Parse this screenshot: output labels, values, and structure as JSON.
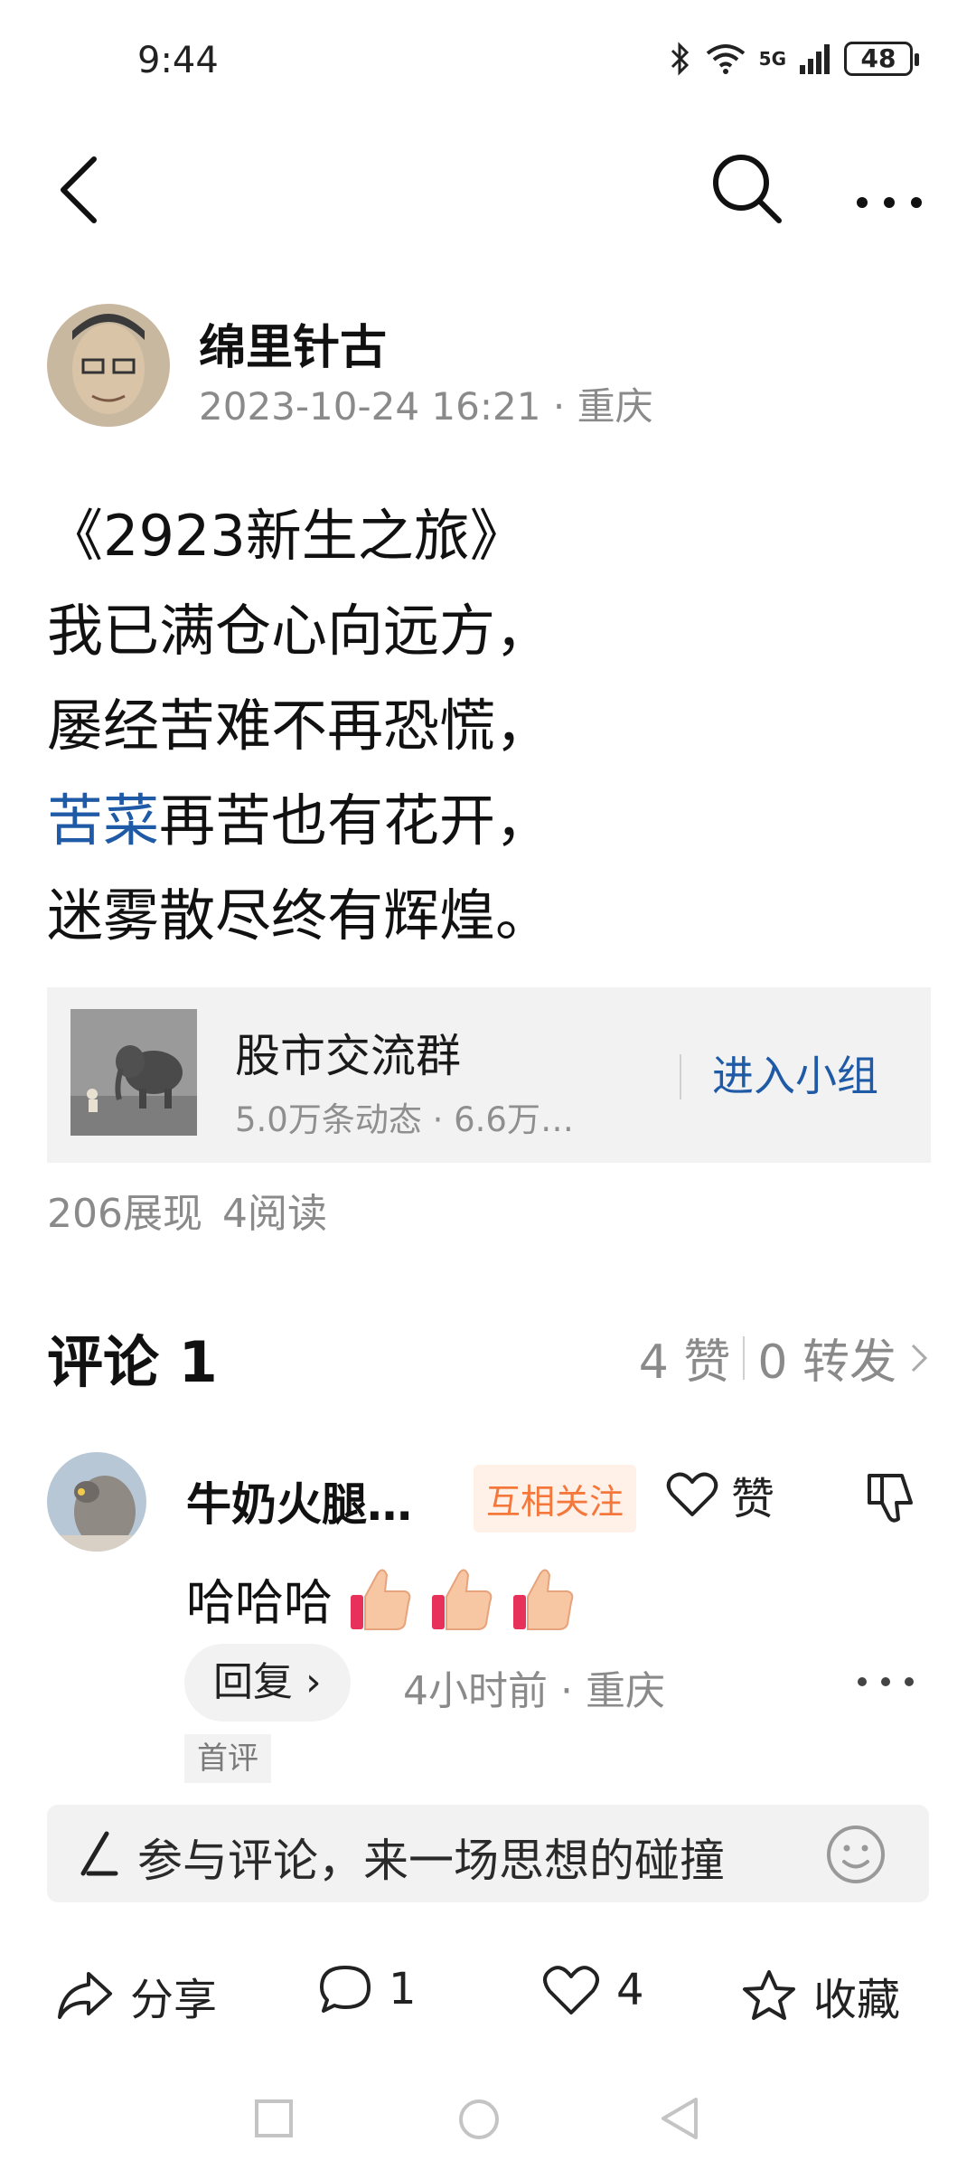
{
  "status_bar": {
    "time": "9:44",
    "network": "5G",
    "battery": "48"
  },
  "nav": {
    "back_icon": "back-arrow-icon",
    "search_icon": "search-icon",
    "more_icon": "more-icon"
  },
  "author": {
    "name": "绵里针古",
    "date": "2023-10-24 16:21",
    "location": "重庆",
    "separator": "·"
  },
  "post": {
    "title_line": "《2923新生之旅》",
    "line2": "我已满仓心向远方，",
    "line3": "屡经苦难不再恐慌，",
    "line4_link": "苦菜",
    "line4_rest": "再苦也有花开，",
    "line5": "迷雾散尽终有辉煌。"
  },
  "group": {
    "name": "股市交流群",
    "stats": "5.0万条动态 · 6.6万…",
    "join_label": "进入小组"
  },
  "post_stats": {
    "impressions": "206展现",
    "reads": "4阅读"
  },
  "comments": {
    "title": "评论 1",
    "likes": "4 赞",
    "shares": "0 转发",
    "items": [
      {
        "name": "牛奶火腿…",
        "badge": "互相关注",
        "like_label": "赞",
        "text": "哈哈哈",
        "reply_label": "回复 ›",
        "meta": "4小时前 · 重庆",
        "first_label": "首评"
      }
    ]
  },
  "comment_input": {
    "placeholder": "参与评论，来一场思想的碰撞"
  },
  "bottom_actions": {
    "share_label": "分享",
    "comment_count": "1",
    "like_count": "4",
    "favorite_label": "收藏"
  },
  "colors": {
    "link": "#1f5aa6",
    "badge_text": "#f4773b",
    "badge_bg": "#fff1e8",
    "muted": "#8a8a8a"
  }
}
